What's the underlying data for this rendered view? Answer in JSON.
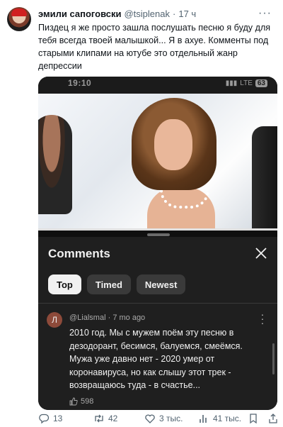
{
  "tweet": {
    "author_name": "эмили сапоговски",
    "handle": "@tsiplenak",
    "separator": "·",
    "time": "17 ч",
    "more": "···",
    "text": "Пиздец я же просто зашла послушать песню я буду для тебя всегда твоей малышкой... Я в ахуе. Комменты под старыми клипами на ютубе это отдельный жанр депрессии"
  },
  "screenshot": {
    "status_time": "19:10",
    "network": "LTE",
    "battery": "63",
    "video_progress": 1.0,
    "comments_panel": {
      "title": "Comments",
      "filters": [
        "Top",
        "Timed",
        "Newest"
      ],
      "active_filter": "Top",
      "comment": {
        "avatar_letter": "Л",
        "author": "@Lialsmal",
        "age": "7 mo ago",
        "text": "2010 год. Мы с мужем поём эту песню в дезодорант, бесимся, балуемся, смеёмся. Мужа уже давно нет - 2020 умер от коронавируса, но как слышу этот трек - возвращаюсь туда - в счастье...",
        "likes": "598"
      }
    }
  },
  "actions": {
    "replies": "13",
    "retweets": "42",
    "likes": "3 тыс.",
    "views": "41 тыс."
  },
  "colors": {
    "text_primary": "#0f1419",
    "text_secondary": "#536471",
    "panel_bg": "#1f1f1f",
    "chip_active_bg": "#f1f1f1"
  }
}
